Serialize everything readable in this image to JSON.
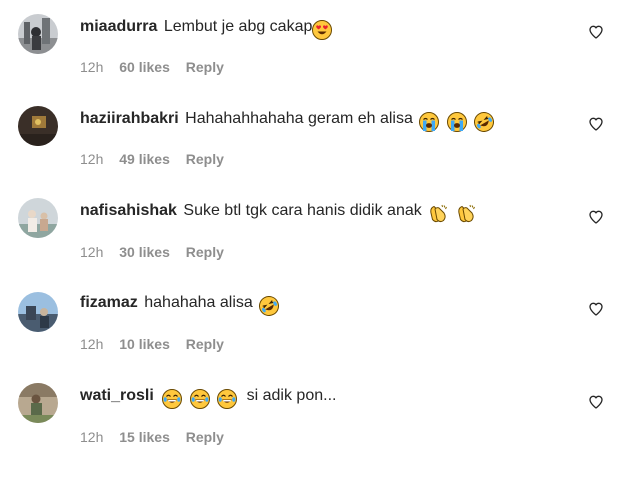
{
  "comments": [
    {
      "username": "miaadurra",
      "text": "Lembut je abg cakap",
      "emojis": [
        "heart-eyes"
      ],
      "time": "12h",
      "likes": "60 likes",
      "reply": "Reply"
    },
    {
      "username": "haziirahbakri",
      "text": "Hahahahhahaha geram eh alisa",
      "emojis": [
        "crying",
        "crying",
        "rofl"
      ],
      "time": "12h",
      "likes": "49 likes",
      "reply": "Reply"
    },
    {
      "username": "nafisahishak",
      "text": "Suke btl tgk cara hanis didik anak",
      "emojis": [
        "clapping",
        "clapping"
      ],
      "time": "12h",
      "likes": "30 likes",
      "reply": "Reply"
    },
    {
      "username": "fizamaz",
      "text": "hahahaha alisa",
      "emojis": [
        "rofl"
      ],
      "time": "12h",
      "likes": "10 likes",
      "reply": "Reply"
    },
    {
      "username": "wati_rosli",
      "text": "si adik pon...",
      "emojis_before_text": [
        "joy",
        "joy",
        "joy"
      ],
      "time": "12h",
      "likes": "15 likes",
      "reply": "Reply"
    }
  ],
  "colors": {
    "text": "#262626",
    "meta": "#8e8e8e",
    "emoji_face": "#FFC83D"
  },
  "icons": {
    "like": "heart-outline-icon"
  }
}
